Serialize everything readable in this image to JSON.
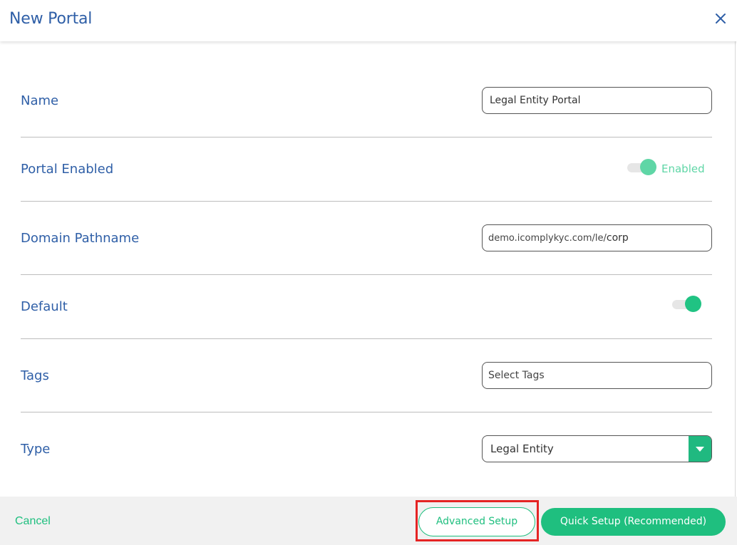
{
  "dialog": {
    "title": "New Portal",
    "close_icon": "close-icon"
  },
  "fields": {
    "name": {
      "label": "Name",
      "value": "Legal Entity Portal"
    },
    "portal_enabled": {
      "label": "Portal Enabled",
      "state": true,
      "state_text": "Enabled"
    },
    "domain_pathname": {
      "label": "Domain Pathname",
      "prefix": "demo.icomplykyc.com/le/",
      "value": "corp"
    },
    "default": {
      "label": "Default",
      "state": true
    },
    "tags": {
      "label": "Tags",
      "placeholder": "Select Tags"
    },
    "type": {
      "label": "Type",
      "selected": "Legal Entity",
      "dropdown_icon": "caret-down-icon"
    }
  },
  "footer": {
    "cancel_label": "Cancel",
    "advanced_label": "Advanced Setup",
    "quick_label": "Quick Setup (Recommended)"
  },
  "colors": {
    "title_blue": "#2f5fa7",
    "accent_green": "#1fbf7f",
    "toggle_light_green": "#5fd6a6",
    "highlight_red": "#e52424"
  }
}
